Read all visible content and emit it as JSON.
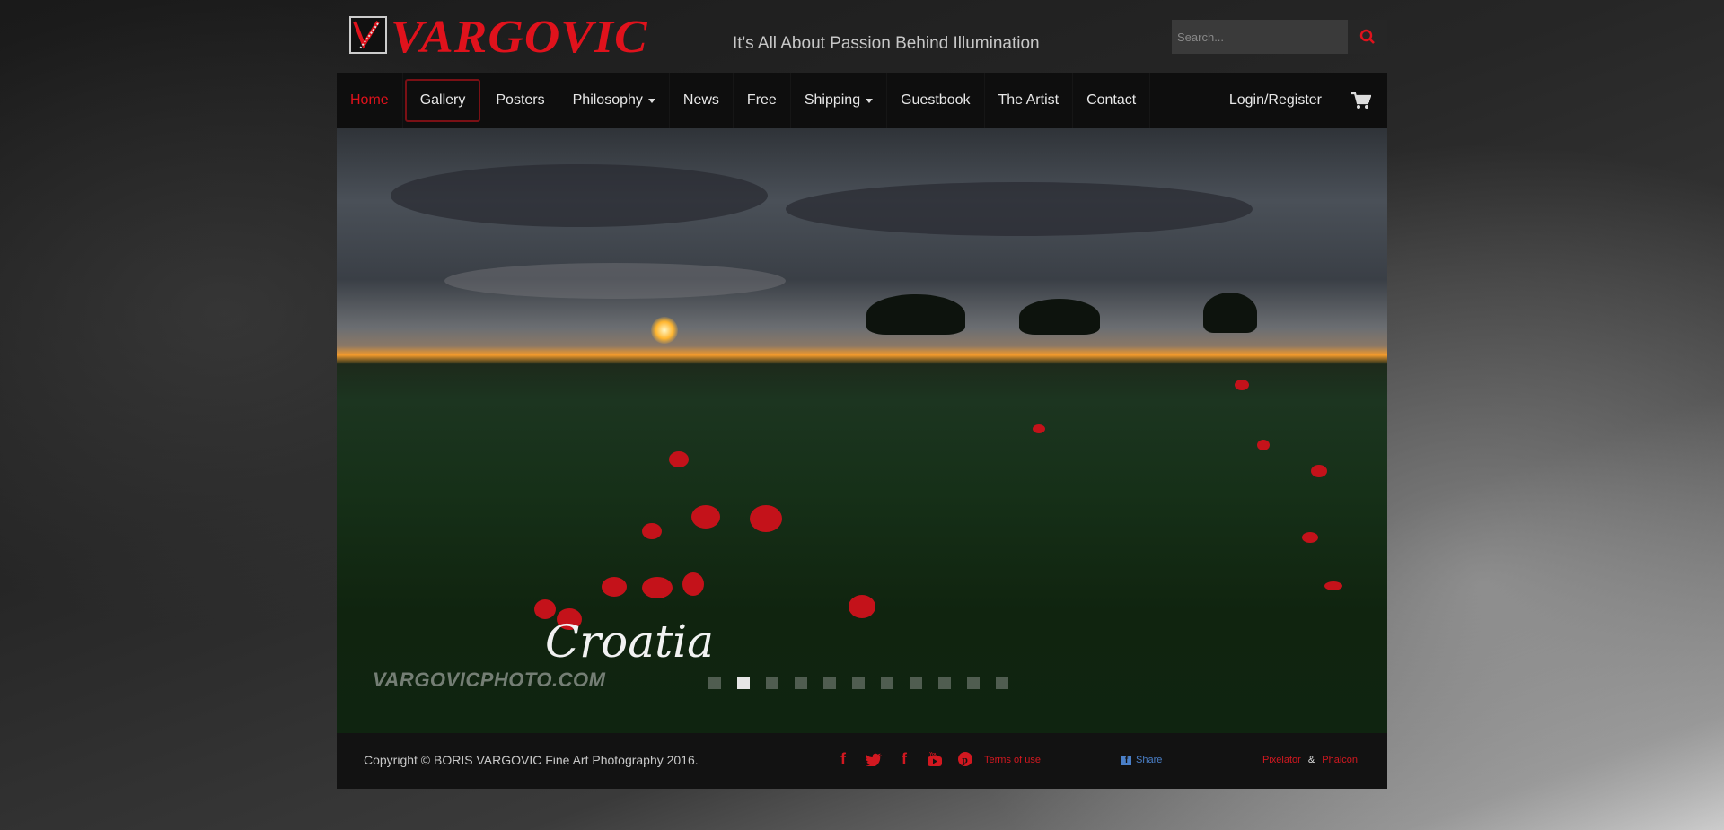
{
  "header": {
    "logo_text": "VARGOVIC",
    "tagline": "It's All About Passion Behind Illumination",
    "search_placeholder": "Search..."
  },
  "nav": {
    "items": [
      {
        "label": "Home",
        "active": true
      },
      {
        "label": "Gallery"
      },
      {
        "label": "Posters"
      },
      {
        "label": "Philosophy",
        "dropdown": true
      },
      {
        "label": "News"
      },
      {
        "label": "Free"
      },
      {
        "label": "Shipping",
        "dropdown": true
      },
      {
        "label": "Guestbook"
      },
      {
        "label": "The Artist"
      },
      {
        "label": "Contact"
      }
    ],
    "login_label": "Login/Register"
  },
  "slider": {
    "caption": "Croatia",
    "watermark": "VARGOVICPHOTO.COM",
    "dot_count": 11,
    "active_dot": 1
  },
  "footer": {
    "copyright": "Copyright © BORIS VARGOVIC Fine Art Photography 2016.",
    "social_icons": [
      "facebook-icon",
      "twitter-icon",
      "facebook-icon",
      "youtube-icon",
      "pinterest-icon"
    ],
    "terms_label": "Terms of use",
    "share_label": "Share",
    "credit_1": "Pixelator",
    "credit_sep": "&",
    "credit_2": "Phalcon"
  },
  "colors": {
    "accent": "#e0121c",
    "navbar": "#0e0e0e",
    "footer": "#121212"
  }
}
